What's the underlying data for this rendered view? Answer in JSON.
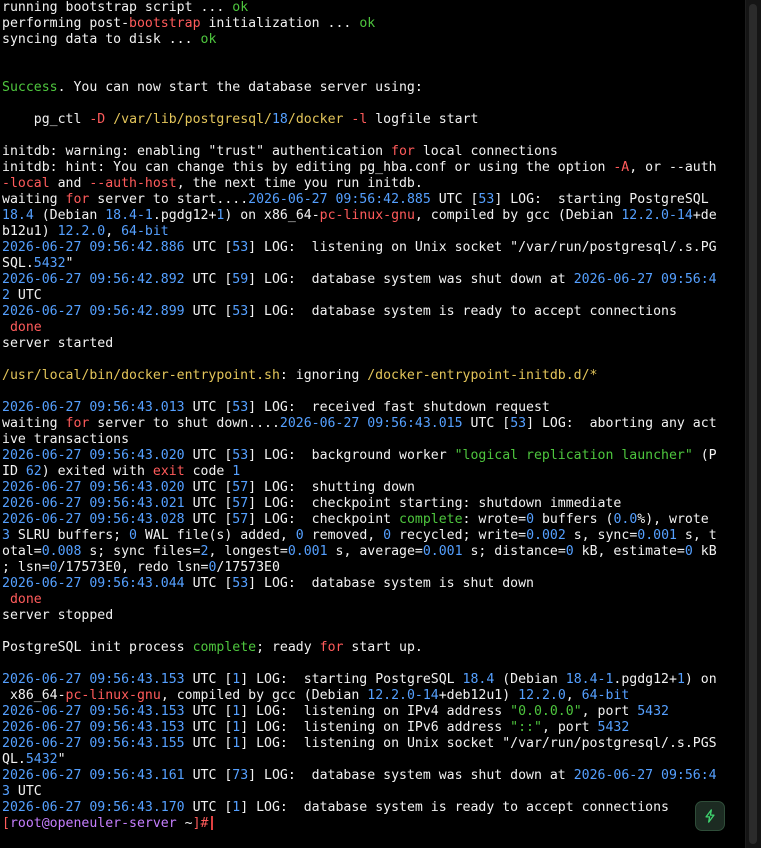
{
  "terminal": {
    "lines": [
      [
        [
          "plain",
          "running bootstrap script ... "
        ],
        [
          "green",
          "ok"
        ]
      ],
      [
        [
          "plain",
          "performing post-"
        ],
        [
          "red",
          "bootstrap"
        ],
        [
          "plain",
          " initialization ... "
        ],
        [
          "green",
          "ok"
        ]
      ],
      [
        [
          "plain",
          "syncing data to disk ... "
        ],
        [
          "green",
          "ok"
        ]
      ],
      [],
      [],
      [
        [
          "green",
          "Success"
        ],
        [
          "plain",
          ". You can now start the database server using:"
        ]
      ],
      [],
      [
        [
          "plain",
          "    pg_ctl "
        ],
        [
          "red",
          "-D"
        ],
        [
          "plain",
          " "
        ],
        [
          "gold",
          "/var/lib/postgresql/"
        ],
        [
          "blue",
          "18"
        ],
        [
          "gold",
          "/docker"
        ],
        [
          "plain",
          " "
        ],
        [
          "red",
          "-l"
        ],
        [
          "plain",
          " logfile start"
        ]
      ],
      [],
      [
        [
          "plain",
          "initdb: warning: enabling \"trust\" authentication "
        ],
        [
          "red",
          "for"
        ],
        [
          "plain",
          " local connections"
        ]
      ],
      [
        [
          "plain",
          "initdb: hint: You can change this by editing pg_hba.conf or using the option "
        ],
        [
          "red",
          "-A"
        ],
        [
          "plain",
          ", or --auth"
        ]
      ],
      [
        [
          "red",
          "-local"
        ],
        [
          "plain",
          " and "
        ],
        [
          "red",
          "--auth-host"
        ],
        [
          "plain",
          ", the next time you run initdb."
        ]
      ],
      [
        [
          "plain",
          "waiting "
        ],
        [
          "red",
          "for"
        ],
        [
          "plain",
          " server to start...."
        ],
        [
          "blue",
          "2026-06-27 09:56:42.885"
        ],
        [
          "plain",
          " UTC ["
        ],
        [
          "blue",
          "53"
        ],
        [
          "plain",
          "] LOG:  starting PostgreSQL"
        ]
      ],
      [
        [
          "blue",
          "18.4"
        ],
        [
          "plain",
          " (Debian "
        ],
        [
          "blue",
          "18.4-1"
        ],
        [
          "plain",
          ".pgdg12+"
        ],
        [
          "blue",
          "1"
        ],
        [
          "plain",
          ") on x86_64-"
        ],
        [
          "red",
          "pc-linux-gnu"
        ],
        [
          "plain",
          ", compiled by gcc (Debian "
        ],
        [
          "blue",
          "12.2.0-14"
        ],
        [
          "plain",
          "+de"
        ]
      ],
      [
        [
          "plain",
          "b12u1) "
        ],
        [
          "blue",
          "12.2.0"
        ],
        [
          "plain",
          ", "
        ],
        [
          "blue",
          "64-bit"
        ]
      ],
      [
        [
          "blue",
          "2026-06-27 09:56:42.886"
        ],
        [
          "plain",
          " UTC ["
        ],
        [
          "blue",
          "53"
        ],
        [
          "plain",
          "] LOG:  listening on Unix socket \"/var/run/postgresql/.s.PG"
        ]
      ],
      [
        [
          "plain",
          "SQL."
        ],
        [
          "blue",
          "5432"
        ],
        [
          "plain",
          "\""
        ]
      ],
      [
        [
          "blue",
          "2026-06-27 09:56:42.892"
        ],
        [
          "plain",
          " UTC ["
        ],
        [
          "blue",
          "59"
        ],
        [
          "plain",
          "] LOG:  database system was shut down at "
        ],
        [
          "blue",
          "2026-06-27 09:56:4"
        ]
      ],
      [
        [
          "blue",
          "2"
        ],
        [
          "plain",
          " UTC"
        ]
      ],
      [
        [
          "blue",
          "2026-06-27 09:56:42.899"
        ],
        [
          "plain",
          " UTC ["
        ],
        [
          "blue",
          "53"
        ],
        [
          "plain",
          "] LOG:  database system is ready to accept connections"
        ]
      ],
      [
        [
          "plain",
          " "
        ],
        [
          "red",
          "done"
        ]
      ],
      [
        [
          "plain",
          "server started"
        ]
      ],
      [],
      [
        [
          "gold",
          "/usr/local/bin/docker-entrypoint.sh"
        ],
        [
          "plain",
          ": ignoring "
        ],
        [
          "gold",
          "/docker-entrypoint-initdb.d/*"
        ]
      ],
      [],
      [
        [
          "blue",
          "2026-06-27 09:56:43.013"
        ],
        [
          "plain",
          " UTC ["
        ],
        [
          "blue",
          "53"
        ],
        [
          "plain",
          "] LOG:  received fast shutdown request"
        ]
      ],
      [
        [
          "plain",
          "waiting "
        ],
        [
          "red",
          "for"
        ],
        [
          "plain",
          " server to shut down...."
        ],
        [
          "blue",
          "2026-06-27 09:56:43.015"
        ],
        [
          "plain",
          " UTC ["
        ],
        [
          "blue",
          "53"
        ],
        [
          "plain",
          "] LOG:  aborting any act"
        ]
      ],
      [
        [
          "plain",
          "ive transactions"
        ]
      ],
      [
        [
          "blue",
          "2026-06-27 09:56:43.020"
        ],
        [
          "plain",
          " UTC ["
        ],
        [
          "blue",
          "53"
        ],
        [
          "plain",
          "] LOG:  background worker "
        ],
        [
          "green",
          "\"logical replication launcher\""
        ],
        [
          "plain",
          " (P"
        ]
      ],
      [
        [
          "plain",
          "ID "
        ],
        [
          "blue",
          "62"
        ],
        [
          "plain",
          ") exited with "
        ],
        [
          "red",
          "exit"
        ],
        [
          "plain",
          " code "
        ],
        [
          "blue",
          "1"
        ]
      ],
      [
        [
          "blue",
          "2026-06-27 09:56:43.020"
        ],
        [
          "plain",
          " UTC ["
        ],
        [
          "blue",
          "57"
        ],
        [
          "plain",
          "] LOG:  shutting down"
        ]
      ],
      [
        [
          "blue",
          "2026-06-27 09:56:43.021"
        ],
        [
          "plain",
          " UTC ["
        ],
        [
          "blue",
          "57"
        ],
        [
          "plain",
          "] LOG:  checkpoint starting: shutdown immediate"
        ]
      ],
      [
        [
          "blue",
          "2026-06-27 09:56:43.028"
        ],
        [
          "plain",
          " UTC ["
        ],
        [
          "blue",
          "57"
        ],
        [
          "plain",
          "] LOG:  checkpoint "
        ],
        [
          "green",
          "complete"
        ],
        [
          "plain",
          ": wrote="
        ],
        [
          "blue",
          "0"
        ],
        [
          "plain",
          " buffers ("
        ],
        [
          "blue",
          "0.0"
        ],
        [
          "plain",
          "%), wrote"
        ]
      ],
      [
        [
          "blue",
          "3"
        ],
        [
          "plain",
          " SLRU buffers; "
        ],
        [
          "blue",
          "0"
        ],
        [
          "plain",
          " WAL file(s) added, "
        ],
        [
          "blue",
          "0"
        ],
        [
          "plain",
          " removed, "
        ],
        [
          "blue",
          "0"
        ],
        [
          "plain",
          " recycled; write="
        ],
        [
          "blue",
          "0.002"
        ],
        [
          "plain",
          " s, sync="
        ],
        [
          "blue",
          "0.001"
        ],
        [
          "plain",
          " s, t"
        ]
      ],
      [
        [
          "plain",
          "otal="
        ],
        [
          "blue",
          "0.008"
        ],
        [
          "plain",
          " s; sync files="
        ],
        [
          "blue",
          "2"
        ],
        [
          "plain",
          ", longest="
        ],
        [
          "blue",
          "0.001"
        ],
        [
          "plain",
          " s, average="
        ],
        [
          "blue",
          "0.001"
        ],
        [
          "plain",
          " s; distance="
        ],
        [
          "blue",
          "0"
        ],
        [
          "plain",
          " kB, estimate="
        ],
        [
          "blue",
          "0"
        ],
        [
          "plain",
          " kB"
        ]
      ],
      [
        [
          "plain",
          "; lsn="
        ],
        [
          "blue",
          "0"
        ],
        [
          "plain",
          "/17573E0, redo lsn="
        ],
        [
          "blue",
          "0"
        ],
        [
          "plain",
          "/17573E0"
        ]
      ],
      [
        [
          "blue",
          "2026-06-27 09:56:43.044"
        ],
        [
          "plain",
          " UTC ["
        ],
        [
          "blue",
          "53"
        ],
        [
          "plain",
          "] LOG:  database system is shut down"
        ]
      ],
      [
        [
          "plain",
          " "
        ],
        [
          "red",
          "done"
        ]
      ],
      [
        [
          "plain",
          "server stopped"
        ]
      ],
      [],
      [
        [
          "plain",
          "PostgreSQL init process "
        ],
        [
          "green",
          "complete"
        ],
        [
          "plain",
          "; ready "
        ],
        [
          "red",
          "for"
        ],
        [
          "plain",
          " start up."
        ]
      ],
      [],
      [
        [
          "blue",
          "2026-06-27 09:56:43.153"
        ],
        [
          "plain",
          " UTC ["
        ],
        [
          "blue",
          "1"
        ],
        [
          "plain",
          "] LOG:  starting PostgreSQL "
        ],
        [
          "blue",
          "18.4"
        ],
        [
          "plain",
          " (Debian "
        ],
        [
          "blue",
          "18.4-1"
        ],
        [
          "plain",
          ".pgdg12+"
        ],
        [
          "blue",
          "1"
        ],
        [
          "plain",
          ") on"
        ]
      ],
      [
        [
          "plain",
          " x86_64-"
        ],
        [
          "red",
          "pc-linux-gnu"
        ],
        [
          "plain",
          ", compiled by gcc (Debian "
        ],
        [
          "blue",
          "12.2.0-14"
        ],
        [
          "plain",
          "+deb12u1) "
        ],
        [
          "blue",
          "12.2.0"
        ],
        [
          "plain",
          ", "
        ],
        [
          "blue",
          "64-bit"
        ]
      ],
      [
        [
          "blue",
          "2026-06-27 09:56:43.153"
        ],
        [
          "plain",
          " UTC ["
        ],
        [
          "blue",
          "1"
        ],
        [
          "plain",
          "] LOG:  listening on IPv4 address "
        ],
        [
          "green",
          "\"0.0.0.0\""
        ],
        [
          "plain",
          ", port "
        ],
        [
          "blue",
          "5432"
        ]
      ],
      [
        [
          "blue",
          "2026-06-27 09:56:43.153"
        ],
        [
          "plain",
          " UTC ["
        ],
        [
          "blue",
          "1"
        ],
        [
          "plain",
          "] LOG:  listening on IPv6 address "
        ],
        [
          "green",
          "\"::\""
        ],
        [
          "plain",
          ", port "
        ],
        [
          "blue",
          "5432"
        ]
      ],
      [
        [
          "blue",
          "2026-06-27 09:56:43.155"
        ],
        [
          "plain",
          " UTC ["
        ],
        [
          "blue",
          "1"
        ],
        [
          "plain",
          "] LOG:  listening on Unix socket \"/var/run/postgresql/.s.PGS"
        ]
      ],
      [
        [
          "plain",
          "QL."
        ],
        [
          "blue",
          "5432"
        ],
        [
          "plain",
          "\""
        ]
      ],
      [
        [
          "blue",
          "2026-06-27 09:56:43.161"
        ],
        [
          "plain",
          " UTC ["
        ],
        [
          "blue",
          "73"
        ],
        [
          "plain",
          "] LOG:  database system was shut down at "
        ],
        [
          "blue",
          "2026-06-27 09:56:4"
        ]
      ],
      [
        [
          "blue",
          "3"
        ],
        [
          "plain",
          " UTC"
        ]
      ],
      [
        [
          "blue",
          "2026-06-27 09:56:43.170"
        ],
        [
          "plain",
          " UTC ["
        ],
        [
          "blue",
          "1"
        ],
        [
          "plain",
          "] LOG:  database system is ready to accept connections"
        ]
      ]
    ],
    "prompt": {
      "open_bracket": "[",
      "user_host": "root@openeuler-server",
      "path": " ~",
      "close": "]#"
    }
  },
  "colors": {
    "background": "#000000",
    "text": "#f2f2f2",
    "green": "#4ec63e",
    "red": "#ff5b5b",
    "blue": "#55a0ff",
    "gold": "#e3c55a",
    "prompt_user": "#c67fff",
    "bolt_button": "#1c2b22",
    "bolt_icon": "#3fd56f"
  },
  "icons": {
    "bolt_button": "lightning-bolt-icon"
  }
}
